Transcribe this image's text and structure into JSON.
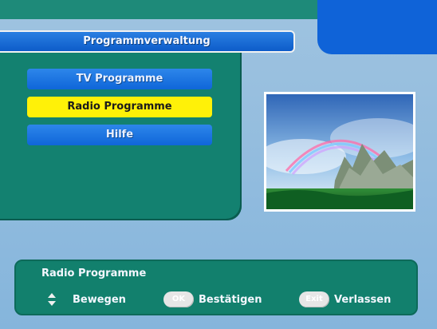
{
  "header": {
    "title": "Programmverwaltung"
  },
  "menu": {
    "items": [
      {
        "label": "TV Programme",
        "selected": false
      },
      {
        "label": "Radio Programme",
        "selected": true
      },
      {
        "label": "Hilfe",
        "selected": false
      }
    ]
  },
  "help": {
    "title": "Radio Programme",
    "hints": [
      {
        "icon": "up-down-arrows-icon",
        "label": "Bewegen"
      },
      {
        "key": "OK",
        "label": "Bestätigen"
      },
      {
        "key": "Exit",
        "label": "Verlassen"
      }
    ]
  },
  "colors": {
    "panel_teal": "#138170",
    "button_blue": "#0f66d9",
    "selected_yellow": "#fff108",
    "background": "#9fc3e0"
  }
}
